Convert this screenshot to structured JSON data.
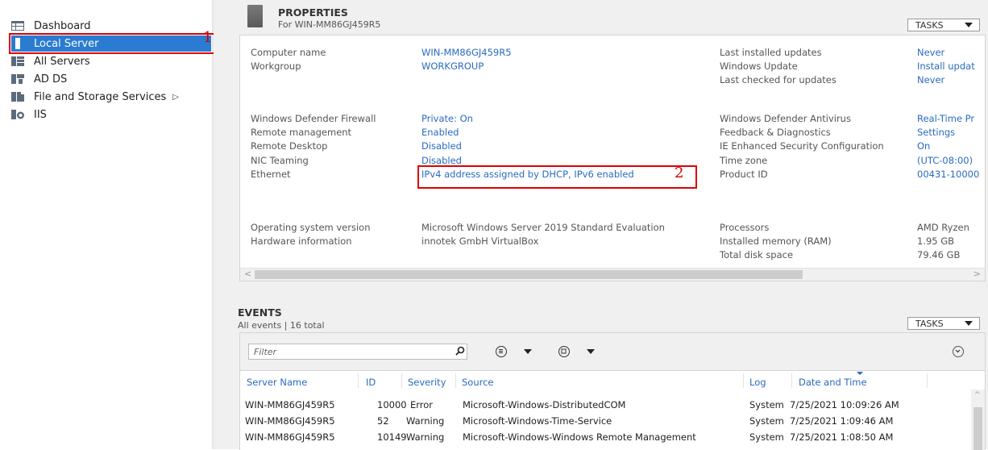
{
  "sidebar": {
    "items": [
      {
        "label": "Dashboard",
        "icon": "dashboard-icon"
      },
      {
        "label": "Local Server",
        "icon": "server-icon",
        "selected": true
      },
      {
        "label": "All Servers",
        "icon": "servers-icon"
      },
      {
        "label": "AD DS",
        "icon": "ad-ds-icon"
      },
      {
        "label": "File and Storage Services",
        "icon": "file-storage-icon",
        "has_submenu": true
      },
      {
        "label": "IIS",
        "icon": "iis-icon"
      }
    ],
    "arrow": "▷"
  },
  "annotations": {
    "one": "1",
    "two": "2"
  },
  "properties": {
    "title": "PROPERTIES",
    "subtitle": "For WIN-MM86GJ459R5",
    "tasks": "TASKS",
    "computer_name_label": "Computer name",
    "computer_name": "WIN-MM86GJ459R5",
    "workgroup_label": "Workgroup",
    "workgroup": "WORKGROUP",
    "last_installed_label": "Last installed updates",
    "last_installed": "Never",
    "windows_update_label": "Windows Update",
    "windows_update": "Install updat",
    "last_checked_label": "Last checked for updates",
    "last_checked": "Never",
    "firewall_label": "Windows Defender Firewall",
    "firewall": "Private: On",
    "remote_mgmt_label": "Remote management",
    "remote_mgmt": "Enabled",
    "remote_desktop_label": "Remote Desktop",
    "remote_desktop": "Disabled",
    "nic_label": "NIC Teaming",
    "nic": "Disabled",
    "ethernet_label": "Ethernet",
    "ethernet": "IPv4 address assigned by DHCP, IPv6 enabled",
    "antivirus_label": "Windows Defender Antivirus",
    "antivirus": "Real-Time Pr",
    "feedback_label": "Feedback & Diagnostics",
    "feedback": "Settings",
    "ie_label": "IE Enhanced Security Configuration",
    "ie": "On",
    "timezone_label": "Time zone",
    "timezone": "(UTC-08:00)",
    "product_id_label": "Product ID",
    "product_id": "00431-10000",
    "os_label": "Operating system version",
    "os": "Microsoft Windows Server 2019 Standard Evaluation",
    "hw_label": "Hardware information",
    "hw": "innotek GmbH VirtualBox",
    "processors_label": "Processors",
    "processors": "AMD Ryzen",
    "ram_label": "Installed memory (RAM)",
    "ram": "1.95 GB",
    "disk_label": "Total disk space",
    "disk": "79.46 GB"
  },
  "events": {
    "title": "EVENTS",
    "subtitle": "All events | 16 total",
    "tasks": "TASKS",
    "filter_placeholder": "Filter",
    "columns": [
      "Server Name",
      "ID",
      "Severity",
      "Source",
      "Log",
      "Date and Time"
    ],
    "rows": [
      [
        "WIN-MM86GJ459R5",
        "10000",
        "Error",
        "Microsoft-Windows-DistributedCOM",
        "System",
        "7/25/2021 10:09:26 AM"
      ],
      [
        "WIN-MM86GJ459R5",
        "52",
        "Warning",
        "Microsoft-Windows-Time-Service",
        "System",
        "7/25/2021 1:09:46 AM"
      ],
      [
        "WIN-MM86GJ459R5",
        "10149",
        "Warning",
        "Microsoft-Windows-Windows Remote Management",
        "System",
        "7/25/2021 1:08:50 AM"
      ]
    ]
  },
  "colors": {
    "accent": "#2a7bd1",
    "link": "#2a6bbf",
    "annotation": "#e00000"
  }
}
